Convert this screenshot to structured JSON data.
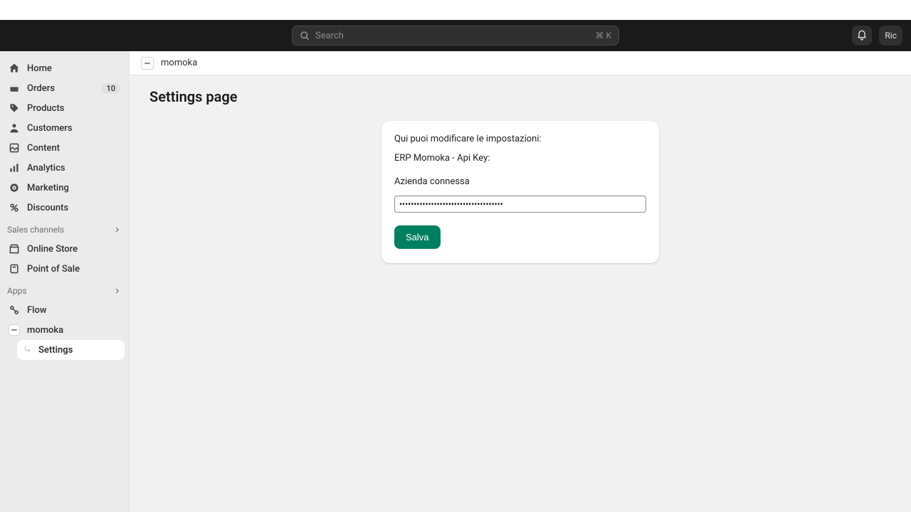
{
  "topbar": {
    "search_placeholder": "Search",
    "search_shortcut": "⌘ K",
    "user_label": "Ric"
  },
  "sidebar": {
    "nav": [
      {
        "key": "home",
        "label": "Home"
      },
      {
        "key": "orders",
        "label": "Orders",
        "badge": "10"
      },
      {
        "key": "products",
        "label": "Products"
      },
      {
        "key": "customers",
        "label": "Customers"
      },
      {
        "key": "content",
        "label": "Content"
      },
      {
        "key": "analytics",
        "label": "Analytics"
      },
      {
        "key": "marketing",
        "label": "Marketing"
      },
      {
        "key": "discounts",
        "label": "Discounts"
      }
    ],
    "sections": {
      "sales_channels": {
        "label": "Sales channels",
        "items": [
          {
            "key": "online-store",
            "label": "Online Store"
          },
          {
            "key": "point-of-sale",
            "label": "Point of Sale"
          }
        ]
      },
      "apps": {
        "label": "Apps",
        "items": [
          {
            "key": "flow",
            "label": "Flow"
          },
          {
            "key": "momoka",
            "label": "momoka",
            "children": [
              {
                "key": "settings",
                "label": "Settings",
                "active": true
              }
            ]
          }
        ]
      }
    }
  },
  "breadcrumb": {
    "app_name": "momoka"
  },
  "page": {
    "title": "Settings page",
    "intro": "Qui puoi modificare le impostazioni:",
    "api_key_label": "ERP Momoka - Api Key:",
    "connection_status": "Azienda connessa",
    "api_key_value": "************************************",
    "save_label": "Salva"
  }
}
